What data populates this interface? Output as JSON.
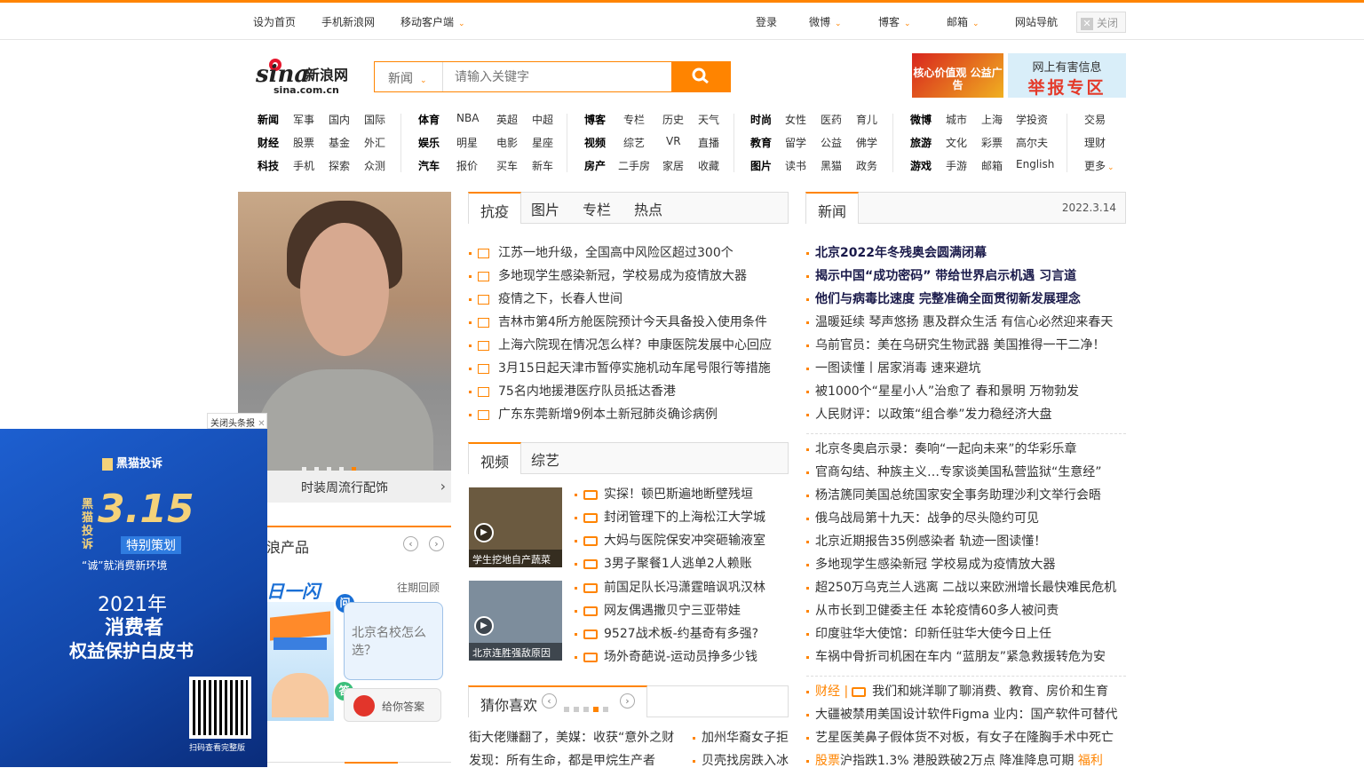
{
  "topbar": {
    "home": "设为首页",
    "mobile": "手机新浪网",
    "client": "移动客户端",
    "login": "登录",
    "weibo": "微博",
    "blog": "博客",
    "mail": "邮箱",
    "sitenav": "网站导航",
    "close": "关闭"
  },
  "logo": {
    "main": "sina新浪网",
    "sub": "sina.com.cn"
  },
  "search": {
    "channel": "新闻",
    "placeholder": "请输入关键字"
  },
  "ads_header": {
    "left": "核心价值观 公益广告",
    "right_top": "网上有害信息",
    "right_bottom": "举报专区"
  },
  "nav": {
    "col1": [
      [
        "新闻",
        "军事",
        "国内",
        "国际"
      ],
      [
        "财经",
        "股票",
        "基金",
        "外汇"
      ],
      [
        "科技",
        "手机",
        "探索",
        "众测"
      ]
    ],
    "col2": [
      [
        "体育",
        "NBA",
        "英超",
        "中超"
      ],
      [
        "娱乐",
        "明星",
        "电影",
        "星座"
      ],
      [
        "汽车",
        "报价",
        "买车",
        "新车"
      ]
    ],
    "col3": [
      [
        "博客",
        "专栏",
        "历史",
        "天气"
      ],
      [
        "视频",
        "综艺",
        "VR",
        "直播"
      ],
      [
        "房产",
        "二手房",
        "家居",
        "收藏"
      ]
    ],
    "col4": [
      [
        "时尚",
        "女性",
        "医药",
        "育儿"
      ],
      [
        "教育",
        "留学",
        "公益",
        "佛学"
      ],
      [
        "图片",
        "读书",
        "黑猫",
        "政务"
      ]
    ],
    "col5": [
      [
        "微博",
        "城市",
        "上海",
        "学投资"
      ],
      [
        "旅游",
        "文化",
        "彩票",
        "高尔夫"
      ],
      [
        "游戏",
        "手游",
        "邮箱",
        "English"
      ]
    ],
    "col6": [
      "交易",
      "理财",
      "更多"
    ]
  },
  "photo": {
    "caption": "时装周流行配饰"
  },
  "tabs1": [
    "抗疫",
    "图片",
    "专栏",
    "热点"
  ],
  "epidemic": [
    "江苏一地升级，全国高中风险区超过300个",
    "多地现学生感染新冠，学校易成为疫情放大器",
    "疫情之下，长春人世间",
    "吉林市第4所方舱医院预计今天具备投入使用条件",
    "上海六院现在情况怎么样？申康医院发展中心回应",
    "3月15日起天津市暂停实施机动车尾号限行等措施",
    "75名内地援港医疗队员抵达香港",
    "广东东莞新增9例本土新冠肺炎确诊病例"
  ],
  "tabs2": [
    "视频",
    "综艺"
  ],
  "video_thumbs": [
    "学生挖地自产蔬菜",
    "北京连胜强敌原因"
  ],
  "videos": [
    "实探！顿巴斯遍地断壁残垣",
    "封闭管理下的上海松江大学城",
    "大妈与医院保安冲突砸输液室",
    "3男子聚餐1人逃单2人赖账",
    "前国足队长冯潇霆暗讽巩汉林",
    "网友偶遇撒贝宁三亚带娃",
    "9527战术板-约基奇有多强?",
    "场外奇葩说-运动员挣多少钱"
  ],
  "guess": {
    "title": "猜你喜欢",
    "items": [
      "街大佬赚翻了，美媒：收获“意外之财",
      "加州华裔女子拒",
      "发现：所有生命，都是甲烷生产者",
      "贝壳找房跌入冰"
    ]
  },
  "news": {
    "tab": "新闻",
    "date": "2022.3.14",
    "headlines": [
      "北京2022年冬残奥会圆满闭幕",
      "揭示中国“成功密码” 带给世界启示机遇 习言道",
      "他们与病毒比速度 完整准确全面贯彻新发展理念"
    ],
    "items1": [
      "温暖延续 琴声悠扬 惠及群众生活 有信心必然迎来春天",
      "乌前官员：美在乌研究生物武器 美国推得一干二净！",
      "一图读懂丨居家消毒 速来避坑",
      "被1000个“星星小人”治愈了 春和景明 万物勃发",
      "人民财评：以政策“组合拳”发力稳经济大盘"
    ],
    "items2": [
      "北京冬奥启示录：奏响“一起向未来”的华彩乐章",
      "官商勾结、种族主义…专家谈美国私营监狱“生意经”",
      "杨洁篪同美国总统国家安全事务助理沙利文举行会晤",
      "俄乌战局第十九天：战争的尽头隐约可见",
      "北京近期报告35例感染者 轨迹一图读懂！",
      "多地现学生感染新冠 学校易成为疫情放大器",
      "超250万乌克兰人逃离 二战以来欧洲增长最快难民危机",
      "从市长到卫健委主任 本轮疫情60多人被问责",
      "印度驻华大使馆：印新任驻华大使今日上任",
      "车祸中骨折司机困在车内 “蓝朋友”紧急救援转危为安"
    ],
    "finance_tag": "财经 |",
    "finance_item": "我们和姚洋聊了聊消费、教育、房价和生育",
    "items3": [
      "大疆被禁用美国设计软件Figma 业内：国产软件可替代",
      "艺星医美鼻子假体货不对板，有女子在隆胸手术中死亡"
    ],
    "stock_tag": "股票",
    "stock_item": "沪指跌1.3% 港股跌破2万点 降准降息可期",
    "welfare": "福利"
  },
  "products": {
    "title": "浪产品",
    "flash": "日一闪",
    "past": "往期回顾",
    "wen": "问",
    "question": "北京名校怎么选？",
    "da": "答",
    "answer": "给你答案"
  },
  "floatad": {
    "close": "关闭头条报",
    "brand": "黑猫投诉",
    "vert": "黑猫投诉",
    "big": "3.15",
    "plan": "特别策划",
    "sub": "“诚”就消费新环境",
    "year": "2021年",
    "t1": "消费者",
    "t2": "权益保护白皮书",
    "scan": "扫码查看完整版"
  }
}
